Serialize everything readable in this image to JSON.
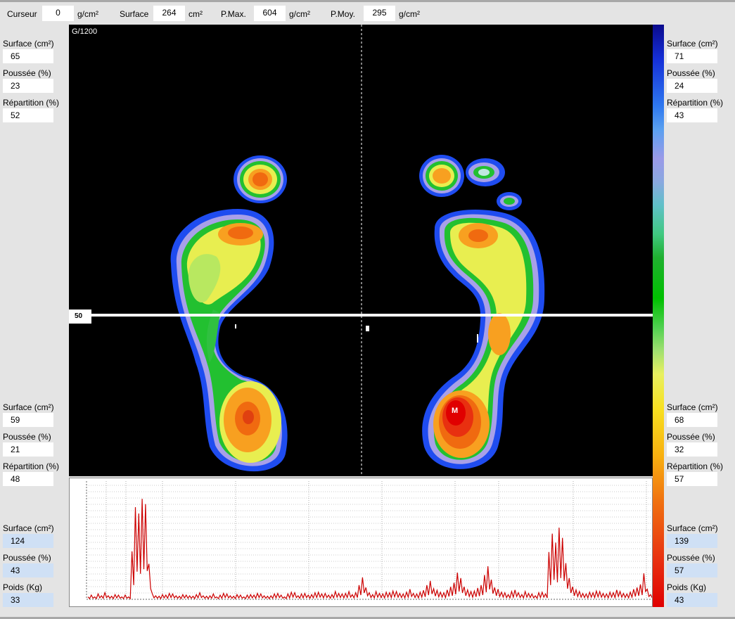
{
  "toolbar": {
    "cursor_label": "Curseur",
    "cursor_value": "0",
    "cursor_unit": "g/cm²",
    "surface_label": "Surface",
    "surface_value": "264",
    "surface_unit": "cm²",
    "pmax_label": "P.Max.",
    "pmax_value": "604",
    "pmax_unit": "g/cm²",
    "pmoy_label": "P.Moy.",
    "pmoy_value": "295",
    "pmoy_unit": "g/cm²"
  },
  "viewer": {
    "scale_label": "G/1200",
    "cursor_line_value": "50",
    "marker_label": "M"
  },
  "labels": {
    "surface": "Surface (cm²)",
    "poussee": "Poussée (%)",
    "repartition": "Répartition (%)",
    "poids": "Poids (Kg)"
  },
  "left": {
    "front": {
      "surface": "65",
      "poussee": "23",
      "repartition": "52"
    },
    "rear": {
      "surface": "59",
      "poussee": "21",
      "repartition": "48"
    },
    "total": {
      "surface": "124",
      "poussee": "43",
      "poids": "33"
    }
  },
  "right": {
    "front": {
      "surface": "71",
      "poussee": "24",
      "repartition": "43"
    },
    "rear": {
      "surface": "68",
      "poussee": "32",
      "repartition": "57"
    },
    "total": {
      "surface": "139",
      "poussee": "57",
      "poids": "43"
    }
  },
  "colors": {
    "background": "#e4e4e4",
    "viewer": "#000000",
    "trace": "#cc0000"
  },
  "graph": {
    "trace_color": "#cc0000",
    "samples": [
      2,
      3,
      2,
      4,
      3,
      5,
      3,
      2,
      4,
      3,
      2,
      3,
      2,
      40,
      78,
      72,
      85,
      80,
      30,
      4,
      3,
      2,
      4,
      3,
      5,
      4,
      3,
      2,
      4,
      3,
      3,
      2,
      4,
      5,
      3,
      2,
      3,
      4,
      2,
      3,
      5,
      4,
      3,
      2,
      4,
      3,
      2,
      3,
      4,
      3,
      5,
      4,
      3,
      2,
      3,
      4,
      5,
      3,
      2,
      4,
      6,
      5,
      3,
      4,
      5,
      3,
      4,
      5,
      6,
      4,
      5,
      3,
      4,
      6,
      5,
      4,
      5,
      6,
      4,
      5,
      12,
      18,
      10,
      5,
      4,
      6,
      5,
      4,
      6,
      5,
      7,
      6,
      5,
      4,
      6,
      8,
      5,
      4,
      6,
      7,
      12,
      15,
      9,
      7,
      6,
      5,
      8,
      10,
      14,
      22,
      18,
      10,
      8,
      6,
      7,
      9,
      12,
      20,
      28,
      16,
      10,
      8,
      6,
      5,
      4,
      6,
      8,
      5,
      4,
      6,
      5,
      4,
      3,
      5,
      6,
      4,
      40,
      55,
      48,
      60,
      52,
      30,
      18,
      10,
      8,
      6,
      5,
      4,
      6,
      5,
      7,
      6,
      5,
      4,
      6,
      5,
      8,
      6,
      5,
      4,
      6,
      8,
      10,
      12,
      22,
      8,
      4
    ]
  }
}
